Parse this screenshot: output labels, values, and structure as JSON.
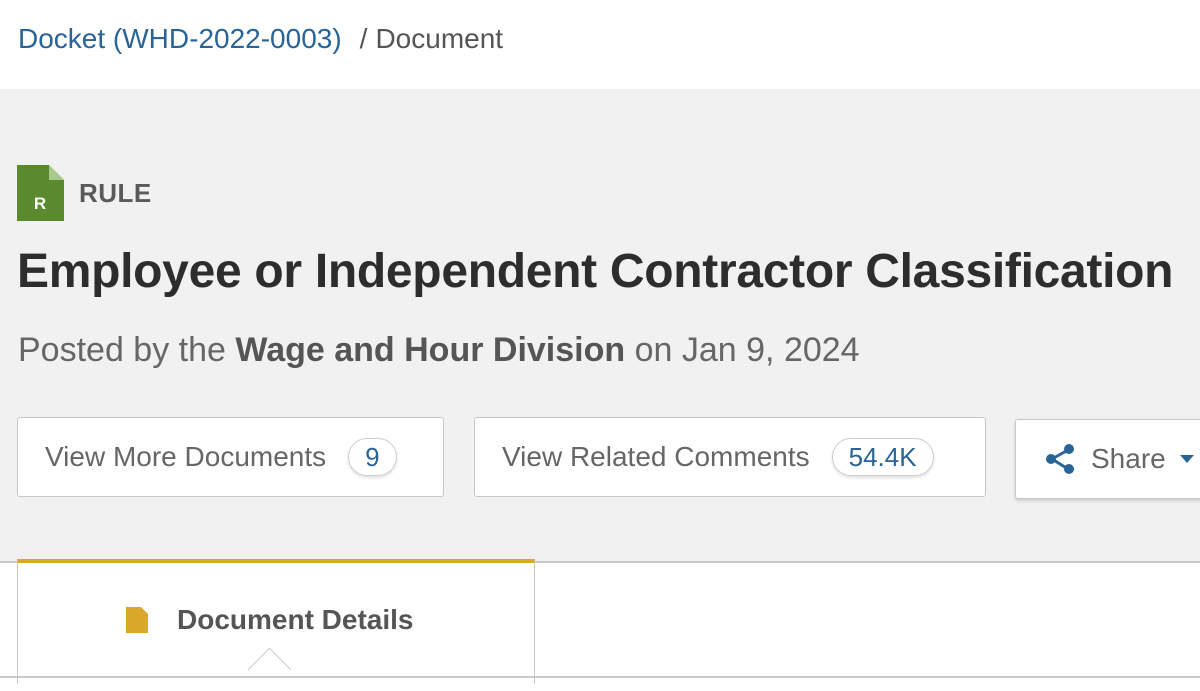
{
  "breadcrumb": {
    "docket_link": "Docket (WHD-2022-0003)",
    "separator": "/",
    "current": "Document"
  },
  "document": {
    "type_letter": "R",
    "type_label": "RULE",
    "title": "Employee or Independent Contractor Classification",
    "posted_prefix": "Posted by the",
    "agency": "Wage and Hour Division",
    "posted_suffix": "on Jan 9, 2024"
  },
  "actions": {
    "view_more_label": "View More Documents",
    "view_more_count": "9",
    "related_comments_label": "View Related Comments",
    "related_comments_count": "54.4K",
    "share_label": "Share"
  },
  "tabs": {
    "active_label": "Document Details"
  },
  "colors": {
    "link": "#2a6496",
    "rule_badge": "#5a8a2e",
    "tab_accent": "#d9a82b"
  }
}
